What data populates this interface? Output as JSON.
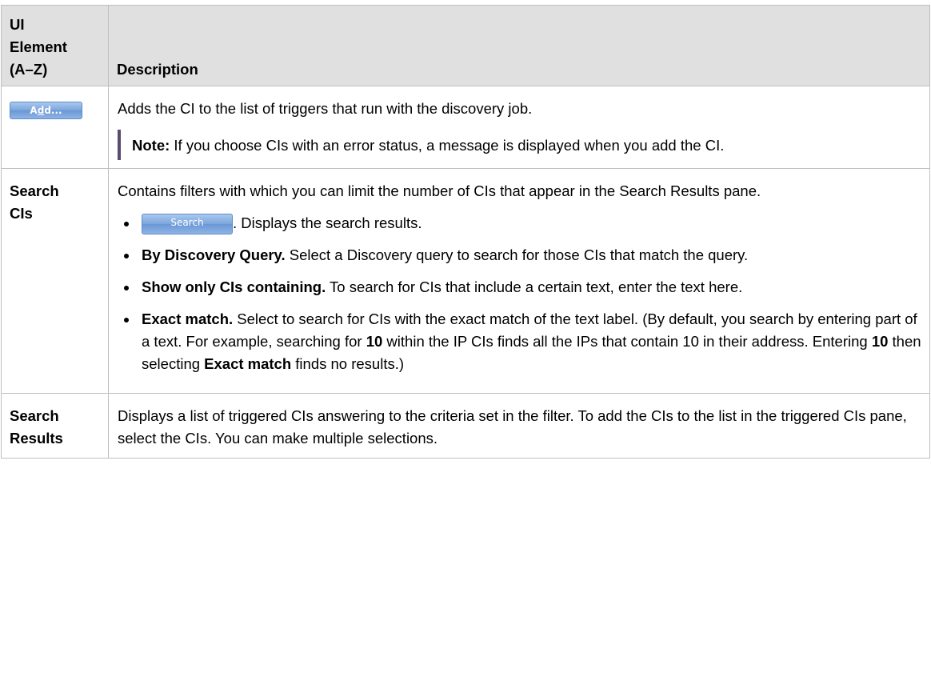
{
  "table": {
    "header": {
      "col1_line1": "UI",
      "col1_line2": "Element",
      "col1_line3": "(A–Z)",
      "col2": "Description"
    },
    "rows": [
      {
        "add_button_pre": "A",
        "add_button_mnemonic": "d",
        "add_button_post": "d...",
        "description": "Adds the CI to the list of triggers that run with the discovery job.",
        "note_label": "Note:",
        "note_text": " If you choose CIs with an error status, a message is displayed when you add the CI."
      },
      {
        "name_line1": "Search",
        "name_line2": "CIs",
        "description": "Contains filters with which you can limit the number of CIs that appear in the Search Results pane.",
        "search_button": "Search",
        "search_button_text": ". Displays the search results.",
        "items": [
          {
            "label": "By Discovery Query.",
            "text": " Select a Discovery query to search for those CIs that match the query."
          },
          {
            "label": "Show only CIs containing.",
            "text": " To search for CIs that include a certain text, enter the text here."
          },
          {
            "label": "Exact match.",
            "text1": " Select to search for CIs with the exact match of the text label. (By default, you search by entering part of a text. For example, searching for ",
            "bold1": "10",
            "text2": " within the IP CIs finds all the IPs that contain 10 in their address. Entering ",
            "bold2": "10",
            "text3": " then selecting ",
            "bold3": "Exact match",
            "text4": " finds no results.)"
          }
        ]
      },
      {
        "name_line1": "Search",
        "name_line2": "Results",
        "description": "Displays a list of triggered CIs answering to the criteria set in the filter. To add the CIs to the list in the triggered CIs pane, select the CIs. You can make multiple selections."
      }
    ]
  }
}
